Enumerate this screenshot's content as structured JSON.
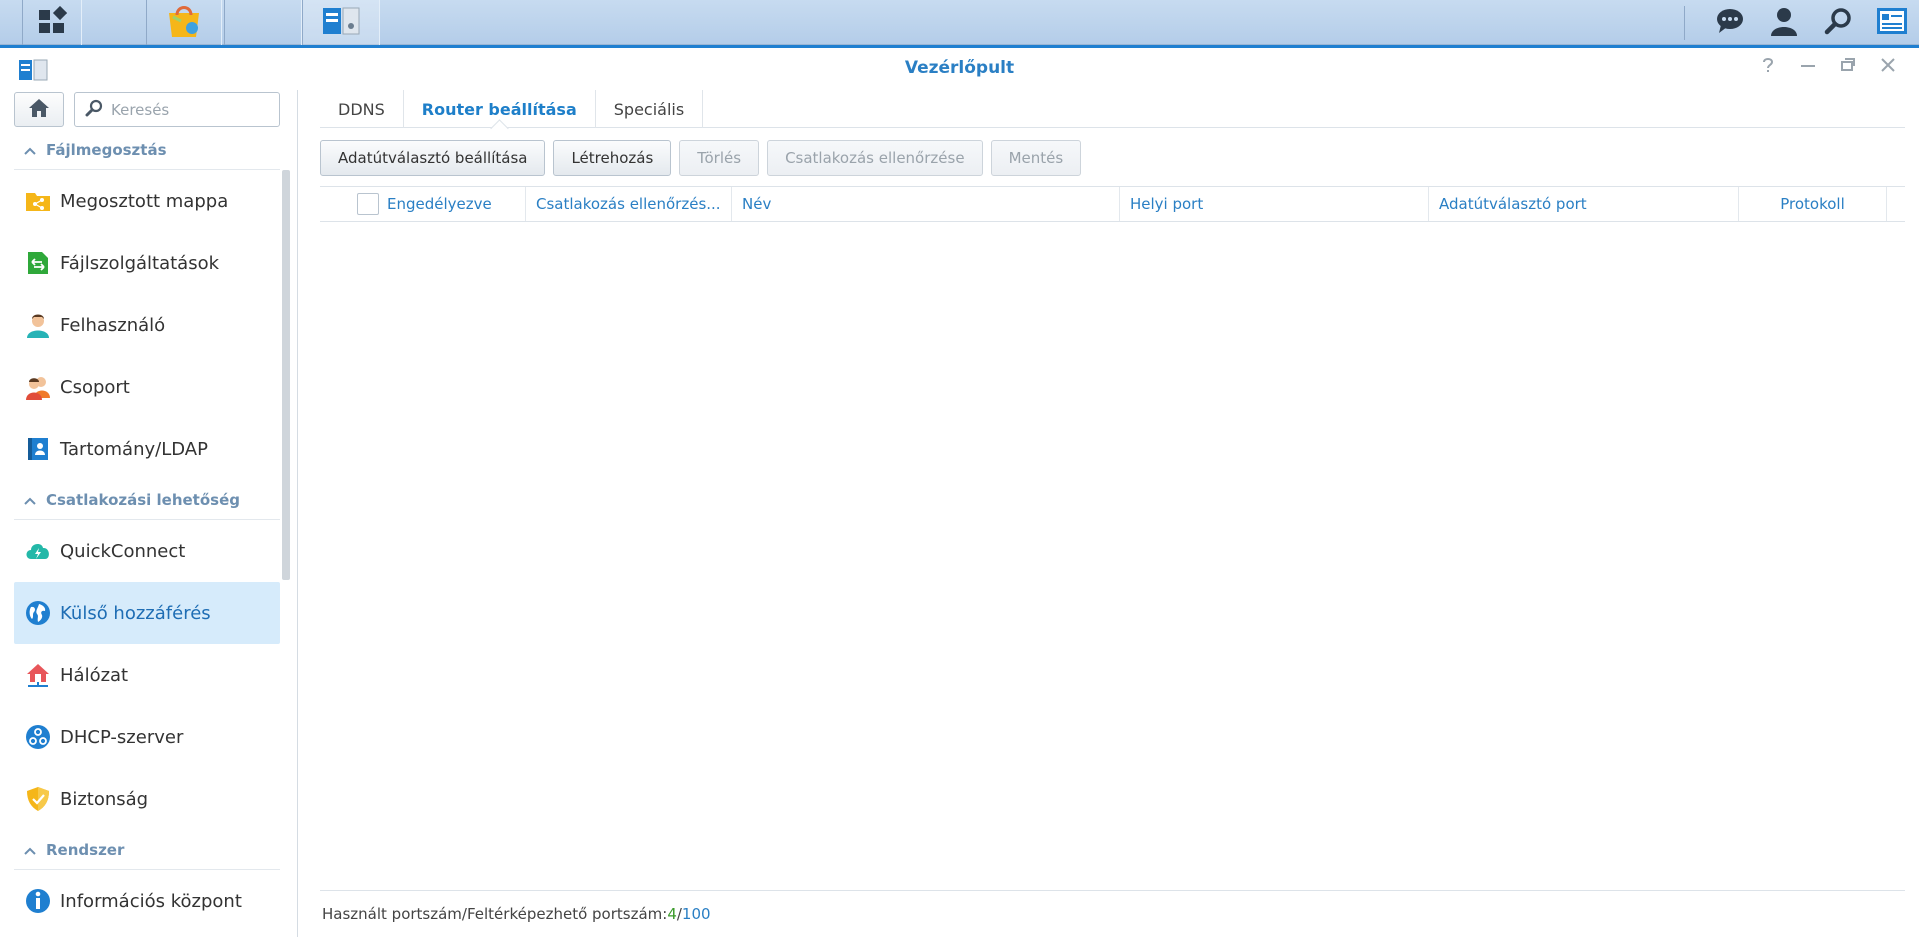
{
  "window": {
    "title": "Vezérlőpult"
  },
  "sidebar": {
    "search_placeholder": "Keresés",
    "sections": [
      {
        "label": "Fájlmegosztás"
      },
      {
        "label": "Csatlakozási lehetőség"
      },
      {
        "label": "Rendszer"
      }
    ],
    "items": [
      {
        "label": "Megosztott mappa",
        "icon": "shared-folder-icon"
      },
      {
        "label": "Fájlszolgáltatások",
        "icon": "file-services-icon"
      },
      {
        "label": "Felhasználó",
        "icon": "user-icon"
      },
      {
        "label": "Csoport",
        "icon": "group-icon"
      },
      {
        "label": "Tartomány/LDAP",
        "icon": "domain-ldap-icon"
      },
      {
        "label": "QuickConnect",
        "icon": "quickconnect-icon"
      },
      {
        "label": "Külső hozzáférés",
        "icon": "external-access-icon"
      },
      {
        "label": "Hálózat",
        "icon": "network-icon"
      },
      {
        "label": "DHCP-szerver",
        "icon": "dhcp-server-icon"
      },
      {
        "label": "Biztonság",
        "icon": "security-icon"
      },
      {
        "label": "Információs központ",
        "icon": "info-center-icon"
      }
    ]
  },
  "tabs": [
    {
      "label": "DDNS"
    },
    {
      "label": "Router beállítása"
    },
    {
      "label": "Speciális"
    }
  ],
  "toolbar": {
    "router_setup": "Adatútválasztó beállítása",
    "create": "Létrehozás",
    "delete": "Törlés",
    "test_connection": "Csatlakozás ellenőrzése",
    "save": "Mentés"
  },
  "grid": {
    "columns": [
      "Engedélyezve",
      "Csatlakozás ellenőrzés...",
      "Név",
      "Helyi port",
      "Adatútválasztó port",
      "Protokoll"
    ]
  },
  "footer": {
    "label": "Használt portszám/Feltérképezhető portszám: ",
    "used": "4",
    "separator": "/",
    "total": "100"
  },
  "colors": {
    "accent": "#2a7fc4",
    "active_bg": "#d6ebfb",
    "used_green": "#3a9a2a"
  }
}
